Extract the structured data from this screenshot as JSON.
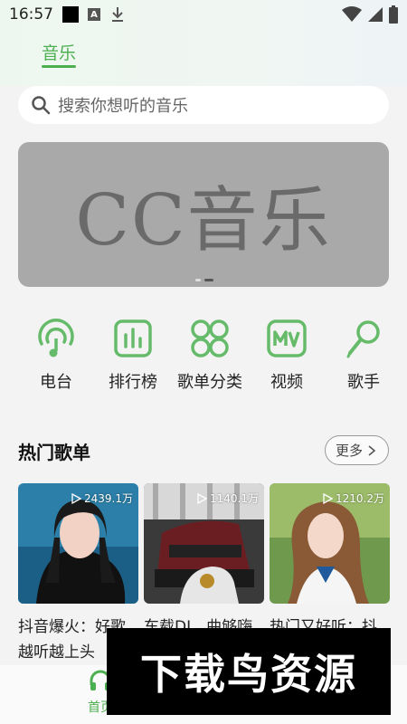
{
  "status_bar": {
    "time": "16:57",
    "badge": "A"
  },
  "header": {
    "active_tab": "音乐",
    "accent_color": "#4caf50"
  },
  "search": {
    "placeholder": "搜索你想听的音乐"
  },
  "banner": {
    "title": "CC音乐",
    "slides": 2,
    "active_slide": 2
  },
  "categories": [
    {
      "label": "电台",
      "icon": "radio-icon"
    },
    {
      "label": "排行榜",
      "icon": "chart-icon"
    },
    {
      "label": "歌单分类",
      "icon": "grid-icon"
    },
    {
      "label": "视频",
      "icon": "mv-icon"
    },
    {
      "label": "歌手",
      "icon": "microphone-icon"
    }
  ],
  "hot_playlists": {
    "title": "热门歌单",
    "more_label": "更多",
    "items": [
      {
        "count": "2439.1万",
        "title_line1": "抖音爆火：好歌",
        "title_line2": "越听越上头"
      },
      {
        "count": "1140.1万",
        "title_line1": "车载DJ，曲够嗨",
        "title_line2": ""
      },
      {
        "count": "1210.2万",
        "title_line1": "热门又好听：抖",
        "title_line2": ""
      }
    ]
  },
  "bottom_nav": {
    "home_label": "首页"
  },
  "watermark": {
    "text": "下载鸟资源"
  }
}
